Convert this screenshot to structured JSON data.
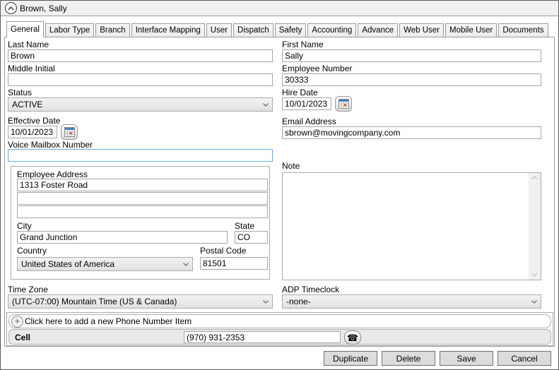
{
  "window": {
    "title": "Brown, Sally"
  },
  "tabs": [
    "General",
    "Labor Type",
    "Branch",
    "Interface Mapping",
    "User",
    "Dispatch",
    "Safety",
    "Accounting",
    "Advance",
    "Web User",
    "Mobile User",
    "Documents"
  ],
  "fields": {
    "last_name": {
      "label": "Last Name",
      "value": "Brown"
    },
    "first_name": {
      "label": "First Name",
      "value": "Sally"
    },
    "middle_initial": {
      "label": "Middle Initial",
      "value": ""
    },
    "employee_number": {
      "label": "Employee Number",
      "value": "30333"
    },
    "status": {
      "label": "Status",
      "value": "ACTIVE"
    },
    "hire_date": {
      "label": "Hire Date",
      "value": "10/01/2023"
    },
    "effective_date": {
      "label": "Effective Date",
      "value": "10/01/2023"
    },
    "email": {
      "label": "Email Address",
      "value": "sbrown@movingcompany.com"
    },
    "voice_mailbox": {
      "label": "Voice Mailbox Number",
      "value": ""
    },
    "address": {
      "group_label": "Employee Address",
      "line1": "1313 Foster Road",
      "line2": "",
      "line3": "",
      "city": {
        "label": "City",
        "value": "Grand Junction"
      },
      "state": {
        "label": "State",
        "value": "CO"
      },
      "country": {
        "label": "Country",
        "value": "United States of America"
      },
      "postal": {
        "label": "Postal Code",
        "value": "81501"
      }
    },
    "note": {
      "label": "Note",
      "value": ""
    },
    "time_zone": {
      "label": "Time Zone",
      "value": "(UTC-07:00) Mountain Time (US & Canada)"
    },
    "adp": {
      "label": "ADP Timeclock",
      "value": "-none-"
    }
  },
  "phone": {
    "add_label": "Click here to add a new Phone Number Item",
    "items": [
      {
        "type": "Cell",
        "number": "(970) 931-2353"
      }
    ]
  },
  "buttons": {
    "duplicate": "Duplicate",
    "delete": "Delete",
    "save": "Save",
    "cancel": "Cancel"
  }
}
